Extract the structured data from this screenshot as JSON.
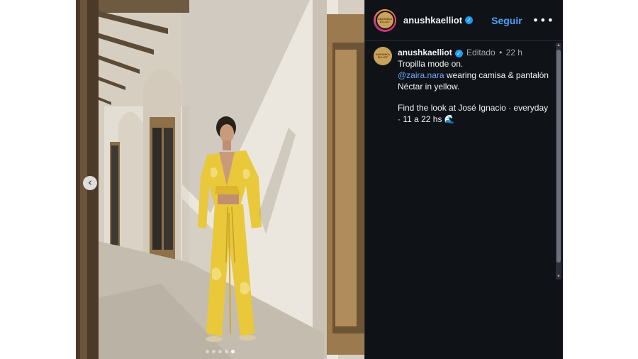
{
  "post": {
    "author": {
      "username": "anushkaelliot",
      "verified": true,
      "avatar_text": "ANUSHKA ELLIOT"
    },
    "header": {
      "follow_label": "Seguir",
      "more_icon": "more-horizontal-icon"
    },
    "caption": {
      "edited_label": "Editado",
      "separator": "•",
      "time": "22 h",
      "line1": "Tropilla mode on.",
      "mention": "@zaira.nara",
      "line2_rest": "wearing camisa & pantalón",
      "line3": "Néctar in yellow.",
      "line4": "Find the look at José Ignacio · everyday",
      "line5": "· 11 a 22 hs 🌊"
    },
    "media": {
      "prev_icon": "chevron-left-icon",
      "slide_count": 5,
      "active_slide": 4
    },
    "colors": {
      "modal_bg": "#0f1217",
      "link": "#4aa3ff",
      "mention": "#6fa9ff",
      "outfit": "#e9c83a"
    }
  }
}
